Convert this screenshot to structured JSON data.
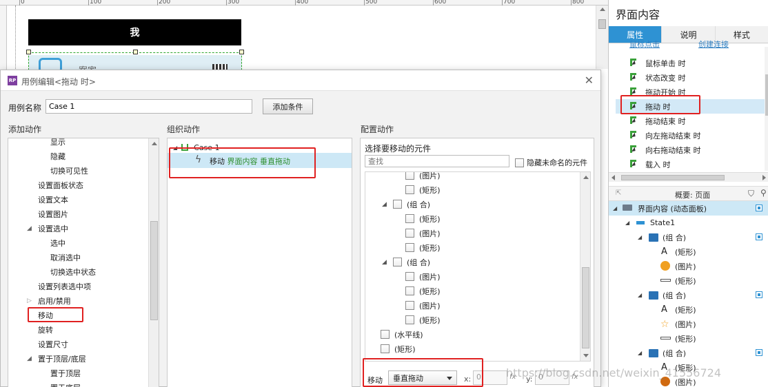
{
  "ruler": {
    "labels": [
      "0",
      "100",
      "200",
      "300",
      "400",
      "500",
      "600",
      "700",
      "800"
    ]
  },
  "canvas": {
    "banner_text": "我",
    "preview_text": "案家"
  },
  "dialog": {
    "icon_text": "RP",
    "title": "用例编辑<拖动 时>",
    "close_glyph": "✕",
    "case_name_label": "用例名称",
    "case_name_value": "Case 1",
    "add_condition_button": "添加条件",
    "add_action_title": "添加动作",
    "organize_action_title": "组织动作",
    "configure_action_title": "配置动作",
    "add_actions": [
      "显示",
      "隐藏",
      "切换可见性",
      "设置面板状态",
      "设置文本",
      "设置图片",
      "设置选中",
      "选中",
      "取消选中",
      "切换选中状态",
      "设置列表选中项",
      "启用/禁用",
      "移动",
      "旋转",
      "设置尺寸",
      "置于顶层/底层",
      "置于顶层",
      "置于底层"
    ],
    "case_node": "Case 1",
    "action_prefix": "移动",
    "action_target": "界面内容 垂直拖动",
    "select_widget_title": "选择要移动的元件",
    "search_placeholder": "查找",
    "hide_unnamed_label": "隐藏未命名的元件",
    "widget_tree": [
      "(图片)",
      "(矩形)",
      "(组 合)",
      "(矩形)",
      "(图片)",
      "(矩形)",
      "(组 合)",
      "(图片)",
      "(矩形)",
      "(图片)",
      "(矩形)",
      "(水平线)",
      "(矩形)"
    ],
    "move_label": "移动",
    "move_select_value": "垂直拖动",
    "x_label": "x:",
    "x_value": "0",
    "y_label": "y:",
    "y_value": "0",
    "fx_label": "fx"
  },
  "side_panel": {
    "title": "界面内容",
    "tabs": [
      "属性",
      "说明",
      "样式"
    ],
    "active_tab": "属性",
    "cut_link_1": "鼠标点击",
    "cut_link_2": "创建连接",
    "events": [
      "鼠标单击 时",
      "状态改变 时",
      "拖动开始 时",
      "拖动 时",
      "拖动结束 时",
      "向左拖动结束 时",
      "向右拖动结束 时",
      "载入 时"
    ],
    "selected_event": "拖动 时",
    "overview_title": "概要: 页面",
    "overview_tree": [
      "界面内容 (动态面板)",
      "State1",
      "(组 合)",
      "(矩形)",
      "(图片)",
      "(矩形)",
      "(组 合)",
      "(矩形)",
      "(图片)",
      "(矩形)",
      "(组 合)",
      "(矩形)",
      "(图片)"
    ]
  },
  "watermark": "https://blog.csdn.net/weixin_41556724",
  "colors": {
    "accent": "#2e92d3",
    "highlight": "#e02020",
    "green": "#2a8c2a"
  }
}
